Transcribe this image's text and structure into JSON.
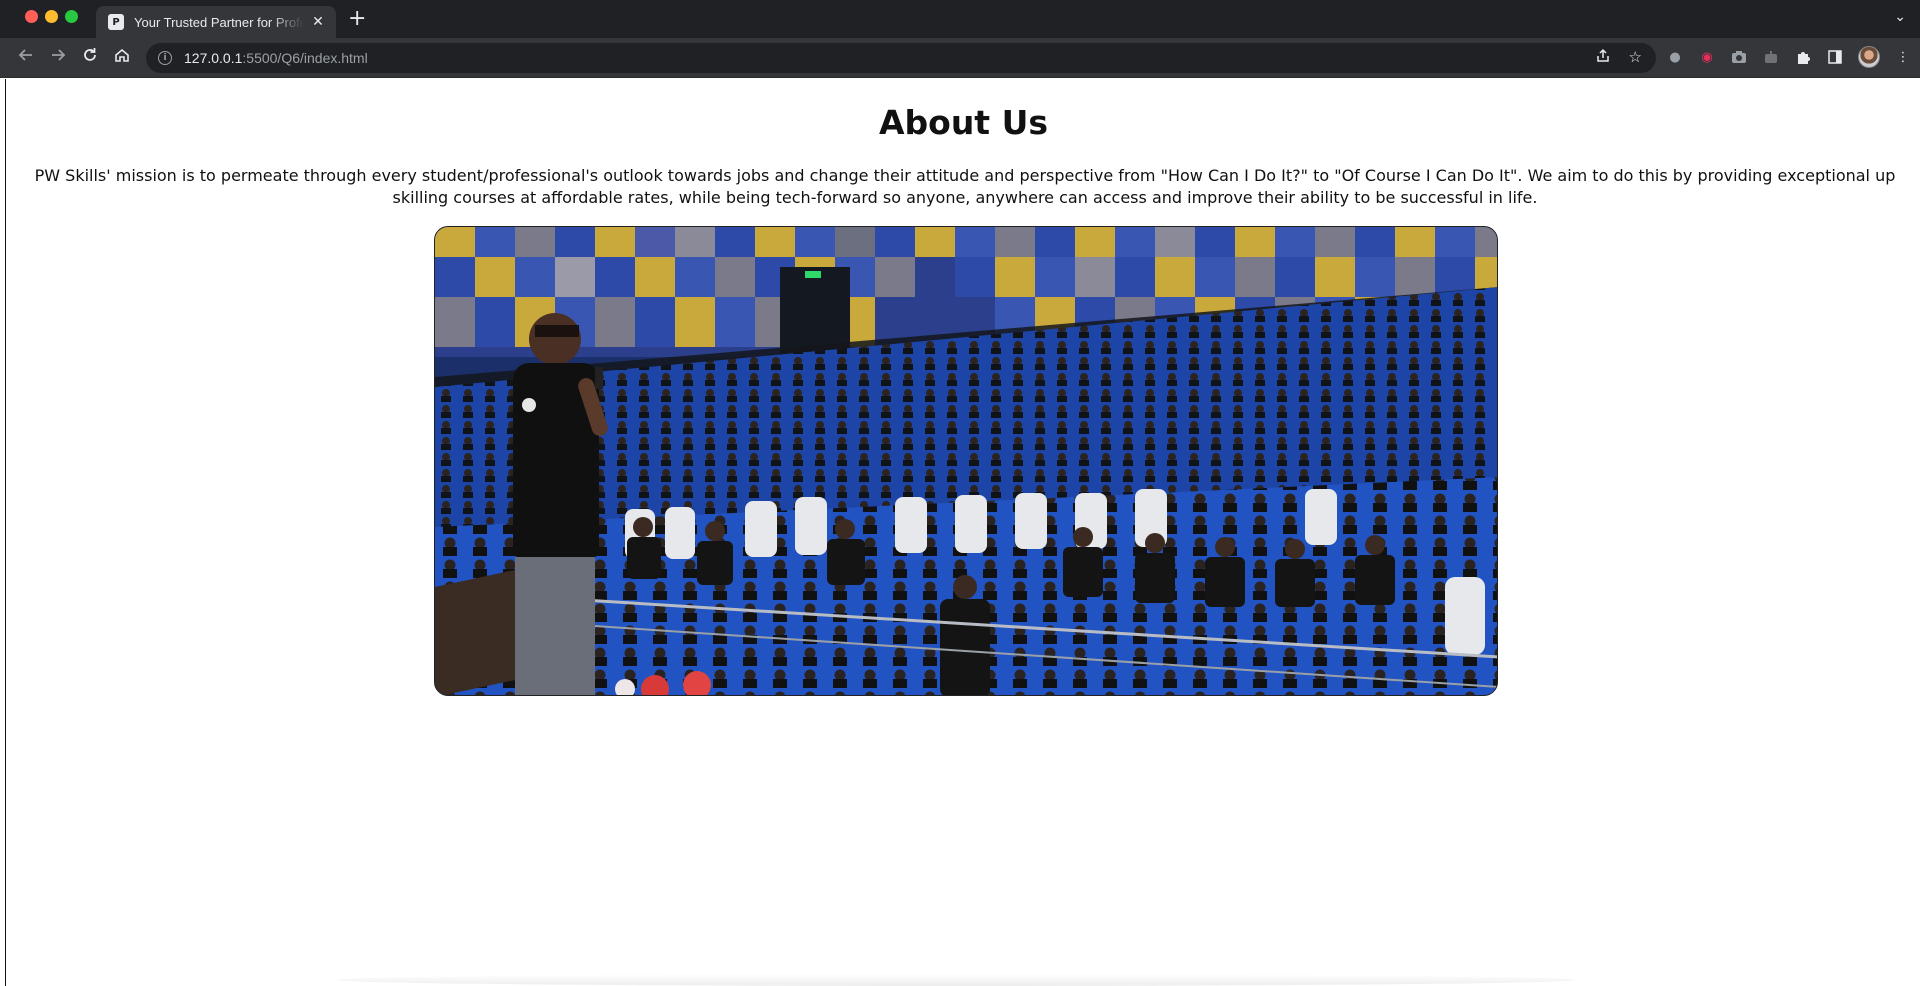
{
  "browser": {
    "tab_title": "Your Trusted Partner for Professional Upskilling",
    "url_host": "127.0.0.1",
    "url_rest": ":5500/Q6/index.html"
  },
  "page": {
    "title": "About Us",
    "mission_text": "PW Skills' mission is to permeate through every student/professional's outlook towards jobs and change their attitude and perspective from \"How Can I Do It?\" to \"Of Course I Can Do It\". We aim to do this by providing exceptional up skilling courses at affordable rates, while being tech-forward so anyone, anywhere can access and improve their ability to be successful in life."
  },
  "colors": {
    "seat_blue": "#1f4fb5",
    "wall_blue": "#2d4aa8",
    "wall_yellow": "#c9a93c",
    "chrome_dark": "#202124",
    "chrome_toolbar": "#35363a"
  },
  "icons": {
    "back": "arrow-left-icon",
    "forward": "arrow-right-icon",
    "reload": "reload-icon",
    "home": "home-icon",
    "info": "info-icon",
    "share": "share-icon",
    "bookmark": "star-icon",
    "extensions": "puzzle-icon",
    "sidepanel": "sidepanel-icon",
    "menu": "kebab-menu-icon"
  }
}
